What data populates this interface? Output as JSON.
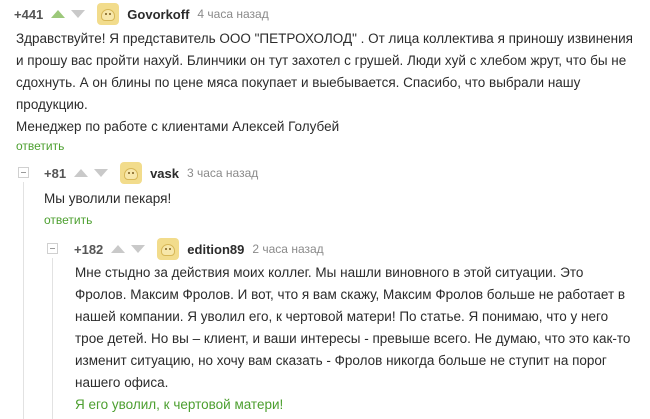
{
  "comment1": {
    "rating": "+441",
    "author": "Govorkoff",
    "time": "4 часа назад",
    "paragraphs": [
      "Здравствуйте! Я представитель ООО \"ПЕТРОХОЛОД\" . От лица коллектива я приношу извинения и прошу вас пройти нахуй. Блинчики он тут захотел с грушей. Люди хуй с хлебом жрут, что бы не сдохнуть. А он блины по цене мяса покупает и выебывается. Спасибо, что выбрали нашу продукцию.",
      "Менеджер по работе с клиентами Алексей Голубей"
    ],
    "reply": "ответить"
  },
  "comment2": {
    "rating": "+81",
    "author": "vask",
    "time": "3 часа назад",
    "text": "Мы уволили пекаря!",
    "reply": "ответить"
  },
  "comment3": {
    "rating": "+182",
    "author": "edition89",
    "time": "2 часа назад",
    "text": "Мне стыдно за действия моих коллег. Мы нашли виновного в этой ситуации. Это Фролов. Максим Фролов. И вот, что я вам скажу, Максим Фролов больше не работает в нашей компании. Я уволил его, к чертовой матери! По статье. Я понимаю, что у него трое детей. Но вы – клиент, и ваши интересы - превыше всего. Не думаю, что это как-то изменит ситуацию, но хочу вам сказать - Фролов никогда больше не ступит на порог нашего офиса.",
    "quote": "Я его уволил, к чертовой матери!"
  },
  "colors": {
    "accent": "#4c9f2f",
    "upvote": "#9cc87a",
    "muted": "#c9c9c9"
  }
}
